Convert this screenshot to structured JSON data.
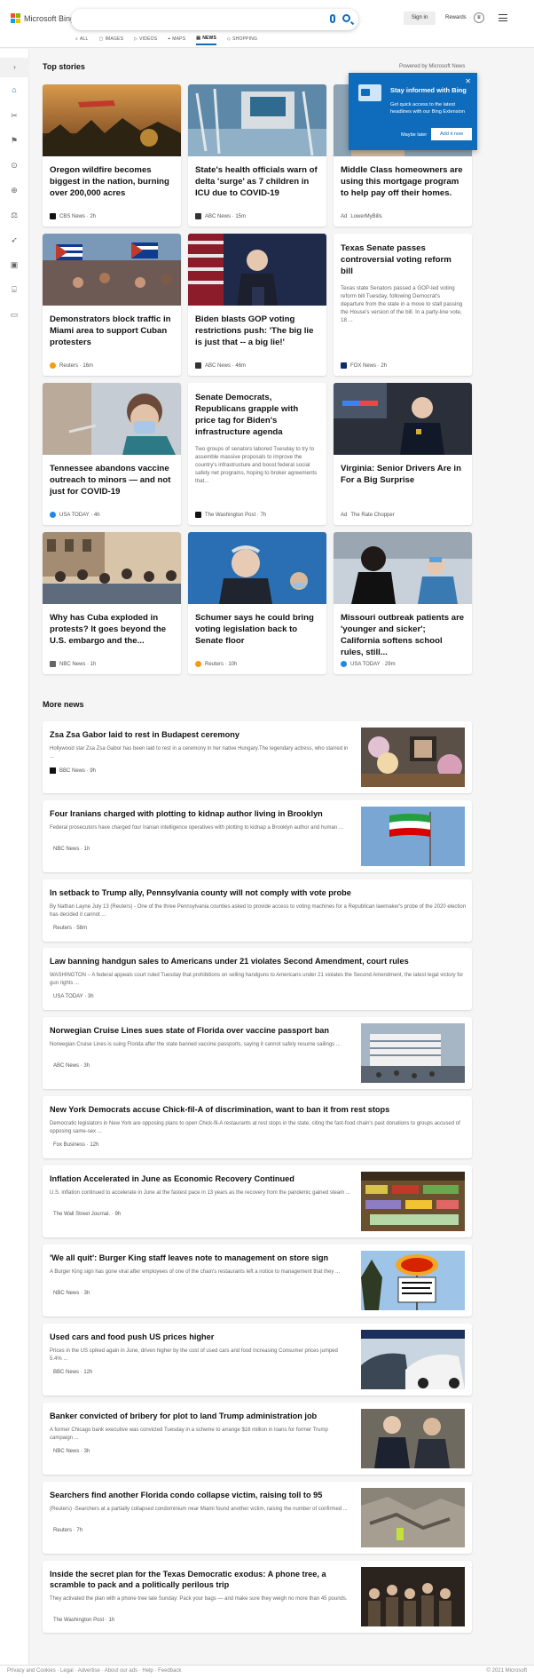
{
  "header": {
    "logo": "Microsoft Bing",
    "search_value": "",
    "signin": "Sign in",
    "rewards": "Rewards",
    "tabs": [
      "ALL",
      "IMAGES",
      "VIDEOS",
      "MAPS",
      "NEWS",
      "SHOPPING"
    ],
    "active_tab": "NEWS"
  },
  "top": {
    "heading": "Top stories",
    "powered": "Powered by Microsoft News"
  },
  "popup": {
    "title": "Stay informed with Bing",
    "text": "Get quick access to the latest headlines with our Bing Extension",
    "maybe": "Maybe later",
    "add": "Add it now"
  },
  "cards": [
    {
      "title": "Oregon wildfire becomes biggest in the nation, burning over 200,000 acres",
      "source": "CBS News · 2h"
    },
    {
      "title": "State's health officials warn of delta 'surge' as 7 children in ICU due to COVID-19",
      "source": "ABC News · 15m"
    },
    {
      "title": "Middle Class homeowners are using this mortgage program to help pay off their homes.",
      "source": "LowerMyBills",
      "ad": "Ad"
    },
    {
      "title": "Demonstrators block traffic in Miami area to support Cuban protesters",
      "source": "Reuters · 16m"
    },
    {
      "title": "Biden blasts GOP voting restrictions push: 'The big lie is just that -- a big lie!'",
      "source": "ABC News · 46m"
    },
    {
      "title": "Texas Senate passes controversial voting reform bill",
      "desc": "Texas state Senators passed a GOP-led voting reform bill Tuesday, following Democrat's departure from the state in a move to stall passing the House's version of the bill.   In a party-line vote, 18 ...",
      "source": "FOX News · 2h"
    },
    {
      "title": "Tennessee abandons vaccine outreach to minors — and not just for COVID-19",
      "source": "USA TODAY · 4h"
    },
    {
      "title": "Senate Democrats, Republicans grapple with price tag for Biden's infrastructure agenda",
      "desc": "Two groups of senators labored Tuesday to try to assemble massive proposals to improve the country's infrastructure and boost federal social safety net programs, hoping to broker agreements that...",
      "source": "The Washington Post · 7h"
    },
    {
      "title": "Virginia: Senior Drivers Are in For a Big Surprise",
      "source": "The Rate Chopper",
      "ad": "Ad"
    },
    {
      "title": "Why has Cuba exploded in protests? It goes beyond the U.S. embargo and the...",
      "source": "NBC News · 1h"
    },
    {
      "title": "Schumer says he could bring voting legislation back to Senate floor",
      "source": "Reuters · 10h"
    },
    {
      "title": "Missouri outbreak patients are 'younger and sicker'; California softens school rules, still...",
      "source": "USA TODAY · 29m"
    }
  ],
  "more": {
    "heading": "More news",
    "items": [
      {
        "title": "Zsa Zsa Gabor laid to rest in Budapest ceremony",
        "desc": "Hollywood star Zsa Zsa Gabor has been laid to rest in a ceremony in her native Hungary.The legendary actress, who starred in ...",
        "source": "BBC News · 9h"
      },
      {
        "title": "Four Iranians charged with plotting to kidnap author living in Brooklyn",
        "desc": "Federal prosecutors have charged four Iranian intelligence operatives with plotting to kidnap a Brooklyn author and human ...",
        "source": "NBC News · 1h"
      },
      {
        "title": "In setback to Trump ally, Pennsylvania county will not comply with vote probe",
        "desc": "By Nathan Layne July 13 (Reuters) - One of the three Pennsylvania counties asked to provide access to voting machines for a Republican lawmaker's probe of the 2020 election has decided it cannot ...",
        "source": "Reuters · 58m"
      },
      {
        "title": "Law banning handgun sales to Americans under 21 violates Second Amendment, court rules",
        "desc": "WASHINGTON – A federal appeals court ruled Tuesday that prohibitions on selling handguns to Americans under 21 violates the Second Amendment, the latest legal victory for gun rights ...",
        "source": "USA TODAY · 3h"
      },
      {
        "title": "Norwegian Cruise Lines sues state of Florida over vaccine passport ban",
        "desc": "Norwegian Cruise Lines is suing Florida after the state banned vaccine passports, saying it cannot safely resume sailings ...",
        "source": "ABC News · 3h"
      },
      {
        "title": "New York Democrats accuse Chick-fil-A of discrimination, want to ban it from rest stops",
        "desc": "Democratic legislators in New York are opposing plans to open Chick-fil-A restaurants at rest stops in the state, citing the fast-food chain's past donations to groups accused of opposing same-sex ...",
        "source": "Fox Business · 12h"
      },
      {
        "title": "Inflation Accelerated in June as Economic Recovery Continued",
        "desc": "U.S. inflation continued to accelerate in June at the fastest pace in 13 years as the recovery from the pandemic gained steam ...",
        "source": "The Wall Street Journal. · 9h"
      },
      {
        "title": "'We all quit': Burger King staff leaves note to management on store sign",
        "desc": "A Burger King sign has gone viral after employees of one of the chain's restaurants left a notice to management that they ...",
        "source": "NBC News · 3h"
      },
      {
        "title": "Used cars and food push US prices higher",
        "desc": "Prices in the US spiked again in June, driven higher by the cost of used cars and food increasing Consumer prices jumped 5.4% ...",
        "source": "BBC News · 12h"
      },
      {
        "title": "Banker convicted of bribery for plot to land Trump administration job",
        "desc": "A former Chicago bank executive was convicted Tuesday in a scheme to arrange $16 million in loans for former Trump campaign ...",
        "source": "NBC News · 3h"
      },
      {
        "title": "Searchers find another Florida condo collapse victim, raising toll to 95",
        "desc": "(Reuters) -Searchers at a partially collapsed condominium near Miami found another victim, raising the number of confirmed ...",
        "source": "Reuters · 7h"
      },
      {
        "title": "Inside the secret plan for the Texas Democratic exodus: A phone tree, a scramble to pack and a politically perilous trip",
        "desc": "They activated the plan with a phone tree late Sunday: Pack your bags — and make sure they weigh no more than 45 pounds.",
        "source": "The Washington Post · 1h"
      }
    ]
  },
  "footer": {
    "left": "Privacy and Cookies · Legal · Advertise · About our ads · Help · Feedback",
    "right": "© 2021 Microsoft"
  }
}
